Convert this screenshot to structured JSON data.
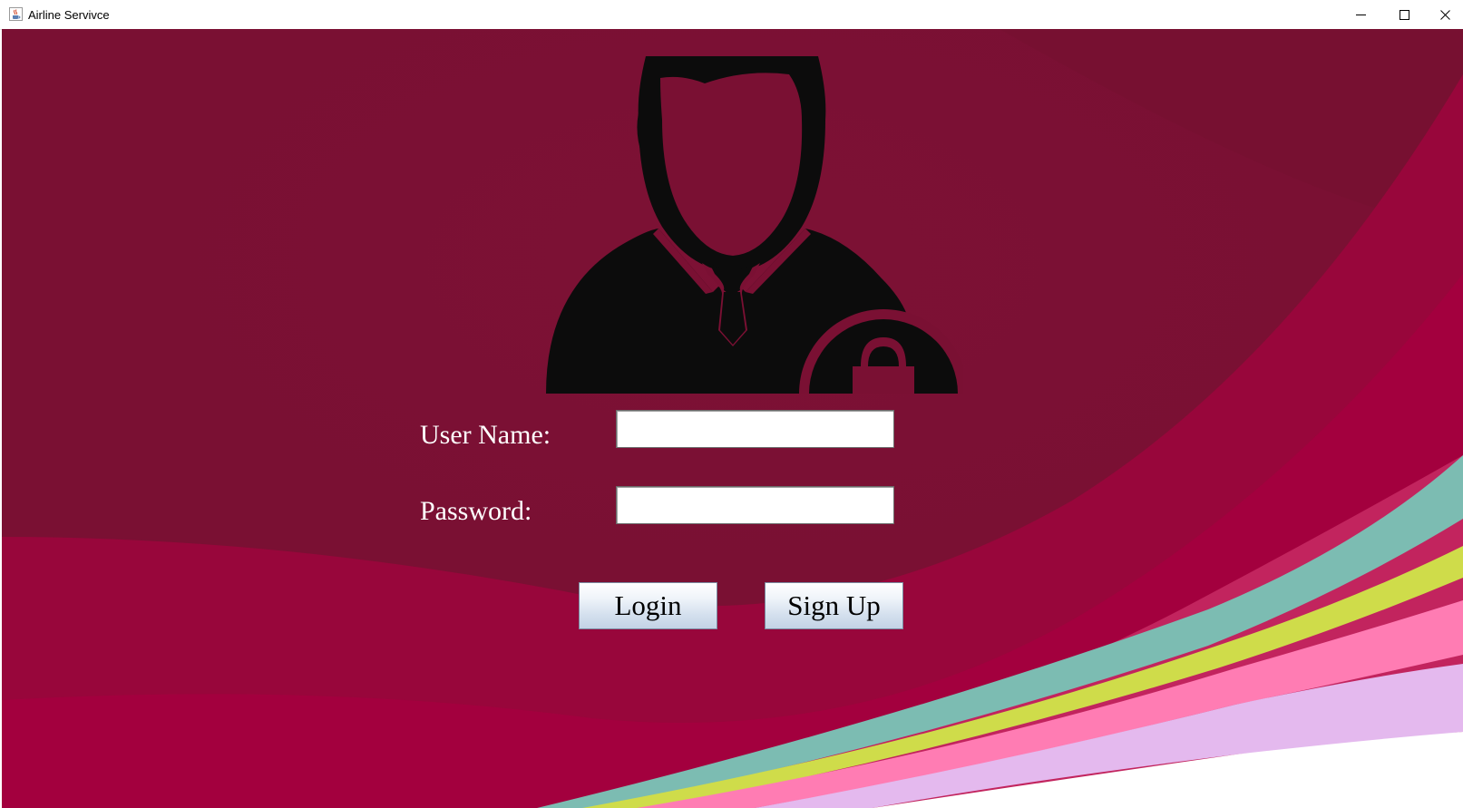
{
  "window": {
    "title": "Airline Servivce",
    "icon": "java-cup-icon",
    "controls": {
      "minimize": "minimize-icon",
      "maximize": "maximize-icon",
      "close": "close-icon"
    }
  },
  "login_form": {
    "avatar_icon": "user-lock-icon",
    "username_label": "User Name:",
    "username_value": "",
    "password_label": "Password:",
    "password_value": "",
    "login_button": "Login",
    "signup_button": "Sign Up"
  },
  "colors": {
    "background": "#7a1033",
    "wave_crimson": "#a3003e",
    "wave_teal": "#7cbcb2",
    "wave_lime": "#cfdc4a",
    "wave_pink": "#ff7cb3",
    "wave_lavender": "#e4b9ee",
    "text": "#ffffff"
  }
}
